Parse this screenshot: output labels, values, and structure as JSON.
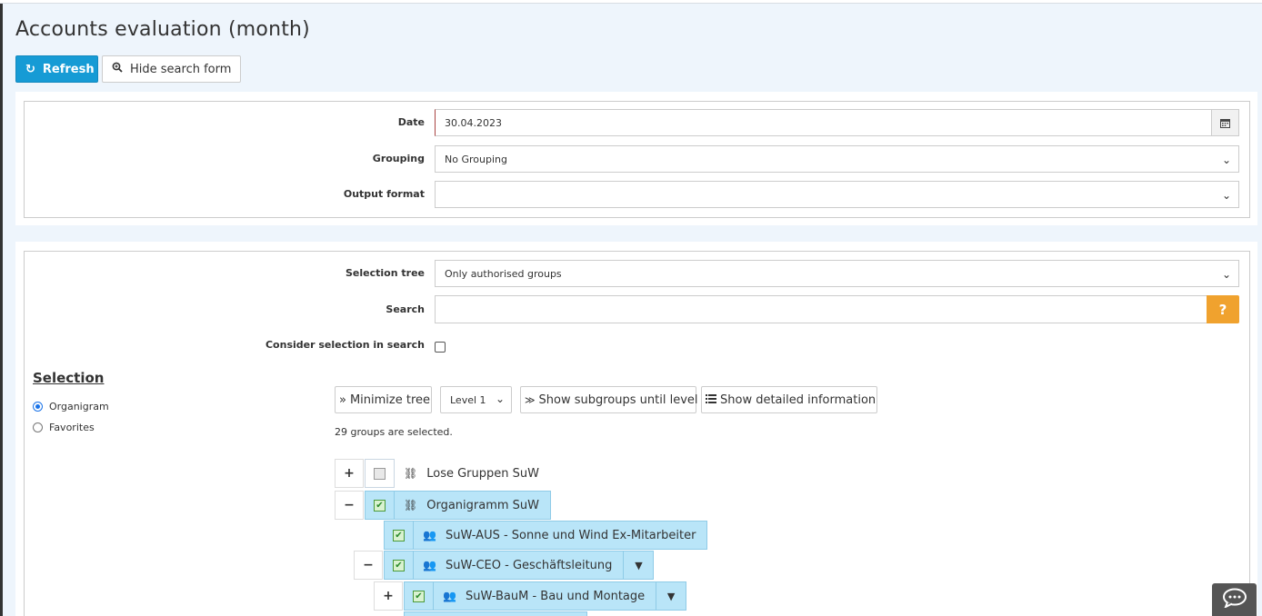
{
  "page": {
    "title": "Accounts evaluation (month)"
  },
  "toolbar": {
    "refresh_label": "Refresh",
    "hide_search_label": "Hide search form"
  },
  "form": {
    "date_label": "Date",
    "date_value": "30.04.2023",
    "grouping_label": "Grouping",
    "grouping_value": "No Grouping",
    "output_label": "Output format",
    "output_value": ""
  },
  "selection_form": {
    "tree_label": "Selection tree",
    "tree_value": "Only authorised groups",
    "search_label": "Search",
    "search_value": "",
    "help_label": "?",
    "consider_label": "Consider selection in search"
  },
  "selection": {
    "title": "Selection",
    "options": [
      {
        "label": "Organigram",
        "checked": true
      },
      {
        "label": "Favorites",
        "checked": false
      }
    ]
  },
  "tree_toolbar": {
    "minimize_label": "Minimize tree",
    "level_value": "Level 1",
    "subgroups_label": "Show subgroups until level",
    "detailed_label": "Show detailed information"
  },
  "status": {
    "selected_text": "29 groups are selected."
  },
  "tree": {
    "nodes": [
      {
        "label": "Lose Gruppen SuW",
        "toggle": "+",
        "selected": false,
        "icon": "sitemap-icon"
      },
      {
        "label": "Organigramm SuW",
        "toggle": "−",
        "selected": true,
        "icon": "sitemap-icon"
      },
      {
        "label": "SuW-AUS - Sonne und Wind Ex-Mitarbeiter",
        "toggle": "",
        "selected": true,
        "icon": "users-icon"
      },
      {
        "label": "SuW-CEO - Geschäftsleitung",
        "toggle": "−",
        "selected": true,
        "icon": "users-icon"
      },
      {
        "label": "SuW-BauM - Bau und Montage",
        "toggle": "+",
        "selected": true,
        "icon": "users-icon"
      }
    ]
  },
  "colors": {
    "primary": "#169bd5",
    "warning": "#f0a22e",
    "selected_bg": "#b9e5f8",
    "page_bg": "#eef5fc"
  }
}
